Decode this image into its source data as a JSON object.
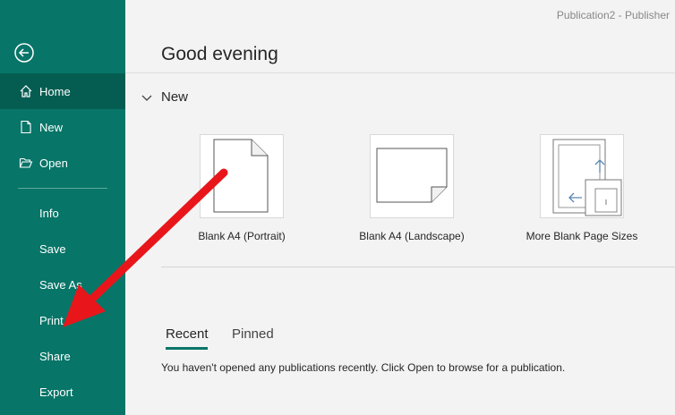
{
  "window": {
    "app_title": "Publication2  -  Publisher"
  },
  "sidebar": {
    "back_label": "Back",
    "items": [
      {
        "label": "Home",
        "icon": "home-icon",
        "active": true
      },
      {
        "label": "New",
        "icon": "new-document-icon"
      },
      {
        "label": "Open",
        "icon": "open-folder-icon"
      },
      {
        "label": "Info"
      },
      {
        "label": "Save"
      },
      {
        "label": "Save As"
      },
      {
        "label": "Print"
      },
      {
        "label": "Share"
      },
      {
        "label": "Export"
      }
    ]
  },
  "main": {
    "greeting": "Good evening",
    "new_section": {
      "label": "New",
      "templates": [
        {
          "label": "Blank A4 (Portrait)",
          "icon": "portrait-page-icon"
        },
        {
          "label": "Blank A4 (Landscape)",
          "icon": "landscape-page-icon"
        },
        {
          "label": "More Blank Page Sizes",
          "icon": "more-page-sizes-icon"
        }
      ]
    },
    "tabs": [
      {
        "label": "Recent",
        "active": true
      },
      {
        "label": "Pinned"
      }
    ],
    "empty_message": "You haven't opened any publications recently. Click Open to browse for a publication."
  },
  "colors": {
    "sidebar_bg": "#077568",
    "sidebar_active": "#055d52",
    "annotation_arrow": "#e8161b"
  }
}
